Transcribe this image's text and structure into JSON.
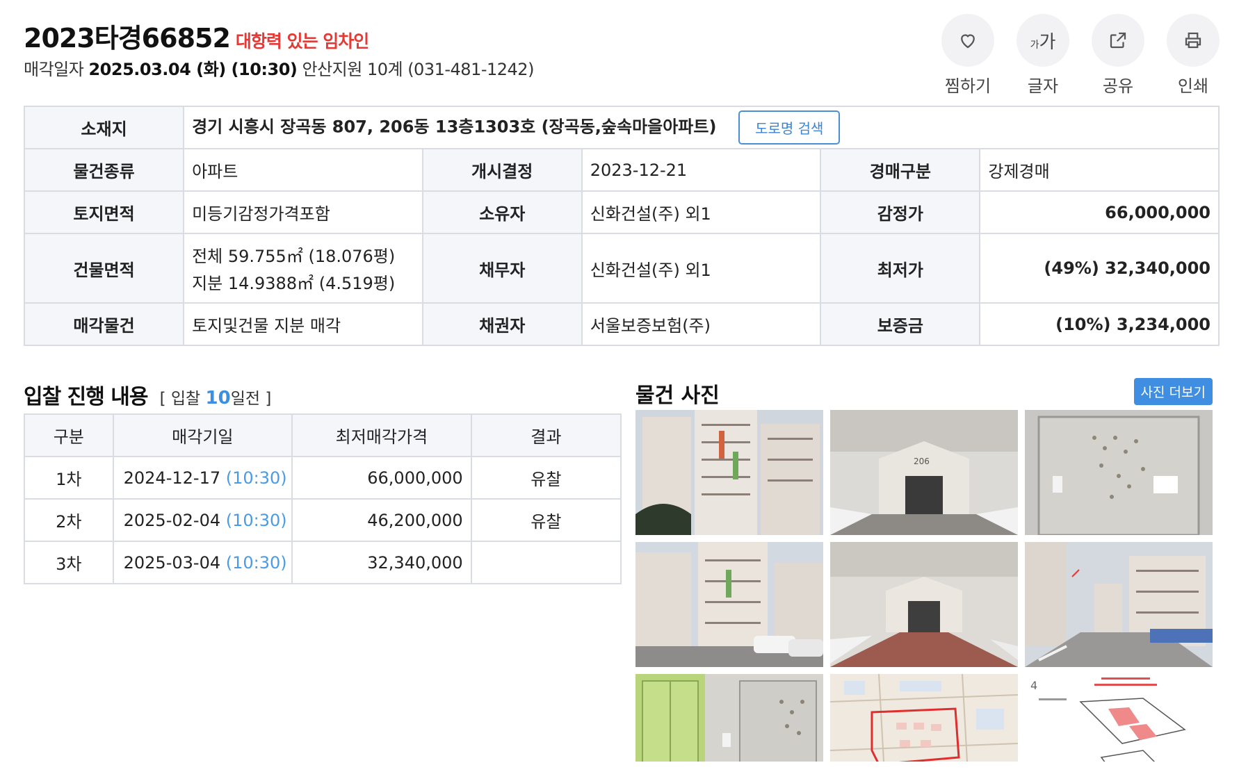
{
  "header": {
    "case_number": "2023타경66852",
    "tag": "대항력 있는 임차인",
    "sale_label": "매각일자",
    "sale_datetime": "2025.03.04 (화) (10:30)",
    "court": "안산지원 10계 (031-481-1242)"
  },
  "actions": [
    {
      "icon": "heart-icon",
      "label": "찜하기"
    },
    {
      "icon": "font-size-icon",
      "label": "글자",
      "glyph_small": "가",
      "glyph_big": "가"
    },
    {
      "icon": "share-icon",
      "label": "공유"
    },
    {
      "icon": "print-icon",
      "label": "인쇄"
    }
  ],
  "info": {
    "location_label": "소재지",
    "location": "경기 시흥시 장곡동 807, 206동 13층1303호 (장곡동,숲속마을아파트)",
    "road_search": "도로명 검색",
    "rows": [
      {
        "l1": "물건종류",
        "v1": "아파트",
        "l2": "개시결정",
        "v2": "2023-12-21",
        "l3": "경매구분",
        "v3": "강제경매"
      },
      {
        "l1": "토지면적",
        "v1": "미등기감정가격포함",
        "l2": "소유자",
        "v2": "신화건설(주) 외1",
        "l3": "감정가",
        "v3": "66,000,000"
      },
      {
        "l1": "건물면적",
        "v1a": "전체 59.755㎡ (18.076평)",
        "v1b": "지분 14.9388㎡ (4.519평)",
        "l2": "채무자",
        "v2": "신화건설(주) 외1",
        "l3": "최저가",
        "v3": "(49%) 32,340,000"
      },
      {
        "l1": "매각물건",
        "v1": "토지및건물 지분 매각",
        "l2": "채권자",
        "v2": "서울보증보험(주)",
        "l3": "보증금",
        "v3": "(10%) 3,234,000"
      }
    ]
  },
  "bids": {
    "title": "입찰 진행 내용",
    "sub_prefix": "[ 입찰",
    "days": "10",
    "sub_suffix": "일전 ]",
    "headers": [
      "구분",
      "매각기일",
      "최저매각가격",
      "결과"
    ],
    "rows": [
      {
        "round": "1차",
        "date": "2024-12-17",
        "time": "(10:30)",
        "price": "66,000,000",
        "result": "유찰"
      },
      {
        "round": "2차",
        "date": "2025-02-04",
        "time": "(10:30)",
        "price": "46,200,000",
        "result": "유찰"
      },
      {
        "round": "3차",
        "date": "2025-03-04",
        "time": "(10:30)",
        "price": "32,340,000",
        "result": ""
      }
    ]
  },
  "photos": {
    "title": "물건 사진",
    "more": "사진 더보기",
    "items": [
      "apartment-exterior-1",
      "building-206-entrance",
      "unit-door",
      "apartment-exterior-2",
      "building-206-entrance-2",
      "complex-street",
      "hallway-doors",
      "location-map",
      "floor-plan"
    ]
  },
  "colors": {
    "accent_blue": "#3f8ee2",
    "alert_red": "#e53935",
    "header_bg": "#f4f6fa",
    "border": "#d9dde3"
  }
}
